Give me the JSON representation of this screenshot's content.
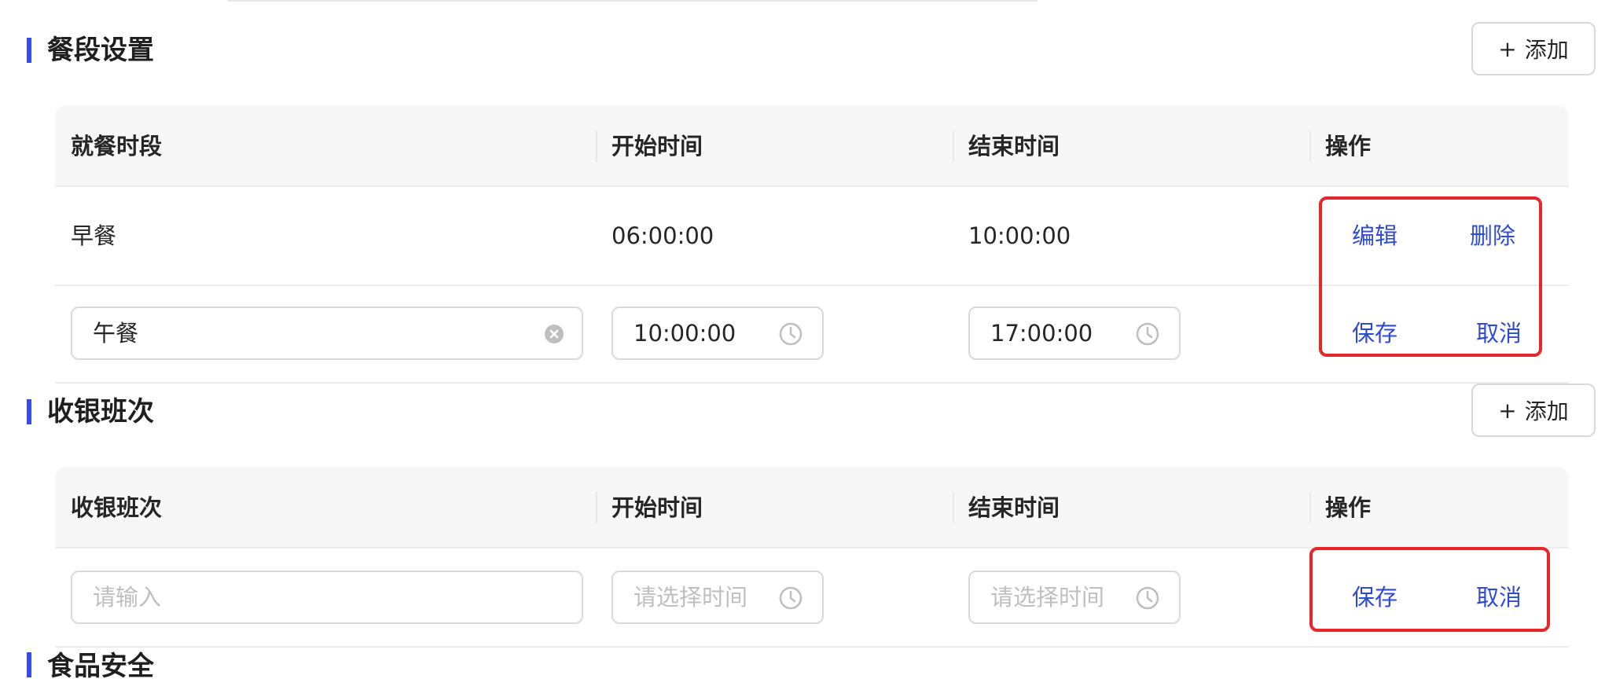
{
  "sections": {
    "meal": {
      "title": "餐段设置",
      "add_label": "添加",
      "columns": [
        "就餐时段",
        "开始时间",
        "结束时间",
        "操作"
      ],
      "rows": [
        {
          "name": "早餐",
          "start": "06:00:00",
          "end": "10:00:00",
          "edit": "编辑",
          "delete": "删除"
        }
      ],
      "edit_row": {
        "name_value": "午餐",
        "start_value": "10:00:00",
        "end_value": "17:00:00",
        "save": "保存",
        "cancel": "取消"
      }
    },
    "cashier": {
      "title": "收银班次",
      "add_label": "添加",
      "columns": [
        "收银班次",
        "开始时间",
        "结束时间",
        "操作"
      ],
      "new_row": {
        "name_placeholder": "请输入",
        "start_placeholder": "请选择时间",
        "end_placeholder": "请选择时间",
        "save": "保存",
        "cancel": "取消"
      }
    },
    "food": {
      "title": "食品安全"
    }
  },
  "colors": {
    "accent": "#3a4ae6",
    "link": "#2f4ad6",
    "highlight": "#e5262b",
    "header_bg": "#f7f7f7"
  },
  "icons": {
    "clear": "clear-circle-icon",
    "clock": "clock-icon",
    "add": "plus-icon"
  }
}
